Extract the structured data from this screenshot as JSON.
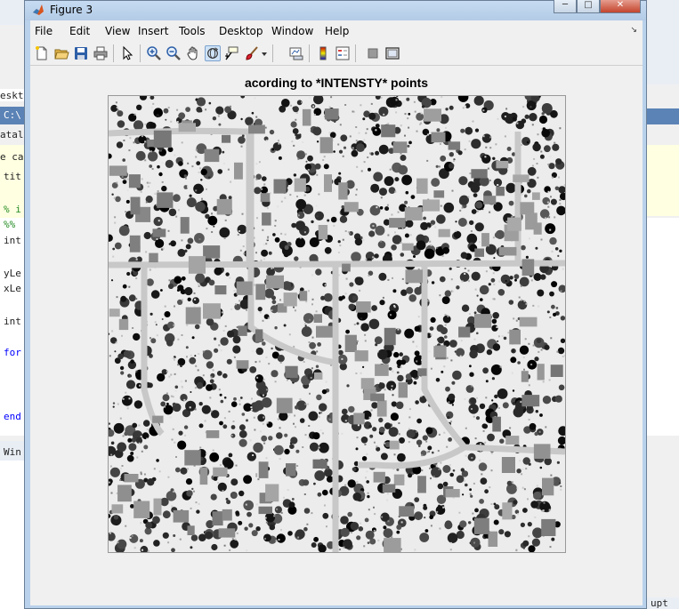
{
  "window": {
    "title": "Figure 3",
    "controls": [
      "minimize",
      "maximize",
      "close"
    ]
  },
  "menubar": [
    {
      "label": "File",
      "mnemonic": "F"
    },
    {
      "label": "Edit",
      "mnemonic": "E"
    },
    {
      "label": "View",
      "mnemonic": "V"
    },
    {
      "label": "Insert",
      "mnemonic": "I"
    },
    {
      "label": "Tools",
      "mnemonic": "T"
    },
    {
      "label": "Desktop",
      "mnemonic": "D"
    },
    {
      "label": "Window",
      "mnemonic": "W"
    },
    {
      "label": "Help",
      "mnemonic": "H"
    }
  ],
  "toolbar": [
    "new-figure-icon",
    "open-file-icon",
    "save-icon",
    "print-icon",
    "edit-plot-arrow-icon",
    "zoom-in-icon",
    "zoom-out-icon",
    "pan-hand-icon",
    "rotate-3d-icon",
    "data-cursor-icon",
    "brush-icon",
    "brush-dropdown-icon",
    "link-plot-icon",
    "insert-colorbar-icon",
    "insert-legend-icon",
    "hide-plot-tools-icon",
    "show-plot-tools-icon"
  ],
  "toolbar_active": "rotate-3d-icon",
  "plot": {
    "title": "acording to *INTENSTY* points",
    "colormap": "gray"
  },
  "background": {
    "code_fragments": [
      "eskto",
      "C:\\",
      "atala",
      "e can",
      "tit",
      "% i",
      "%%",
      "int",
      "yLe",
      "xLe",
      "int",
      "for",
      "end",
      "Win"
    ],
    "right_fragments": [
      "upt"
    ]
  },
  "colors": {
    "titlebar": "#b9d1ea",
    "client": "#f0f0f0",
    "menu_text": "#000000"
  }
}
